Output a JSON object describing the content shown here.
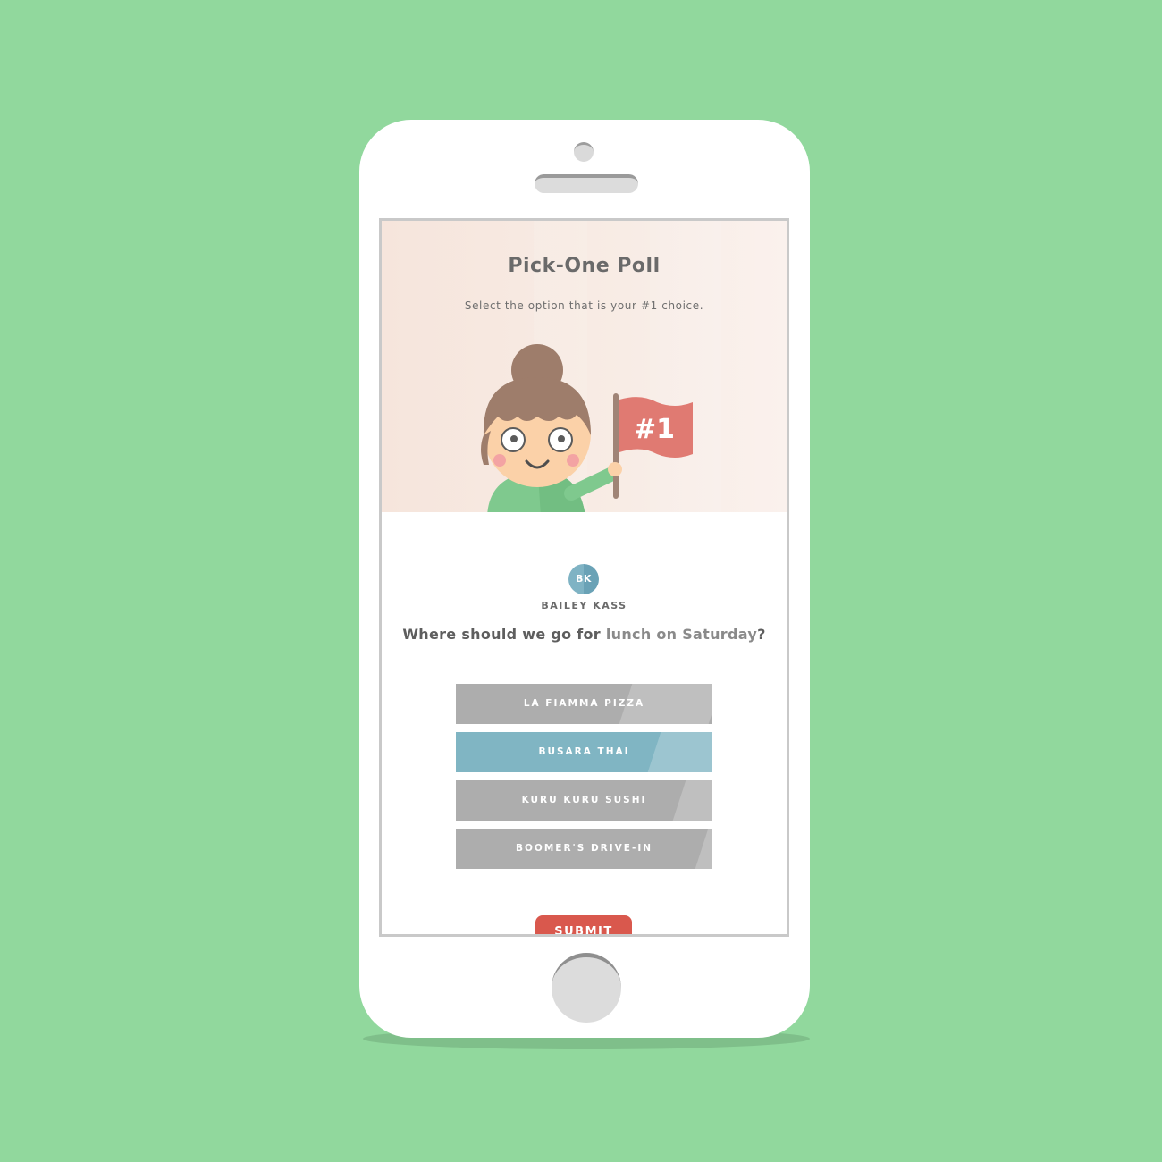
{
  "poll": {
    "title": "Pick-One Poll",
    "subtitle": "Select the option that is your #1 choice.",
    "flag_text": "#1"
  },
  "author": {
    "initials": "BK",
    "name": "BAILEY KASS"
  },
  "question": {
    "lead": "Where should we go for ",
    "accent": "lunch on Saturday",
    "trail": "?"
  },
  "options": [
    {
      "label": "LA FIAMMA PIZZA",
      "selected": false
    },
    {
      "label": "BUSARA THAI",
      "selected": true
    },
    {
      "label": "KURU KURU SUSHI",
      "selected": false
    },
    {
      "label": "BOOMER'S DRIVE-IN",
      "selected": false
    }
  ],
  "submit_label": "SUBMIT",
  "colors": {
    "background": "#91d89d",
    "selected_option": "#80b5c3",
    "option": "#adadad",
    "submit": "#d9584d",
    "flag": "#e07a72"
  }
}
